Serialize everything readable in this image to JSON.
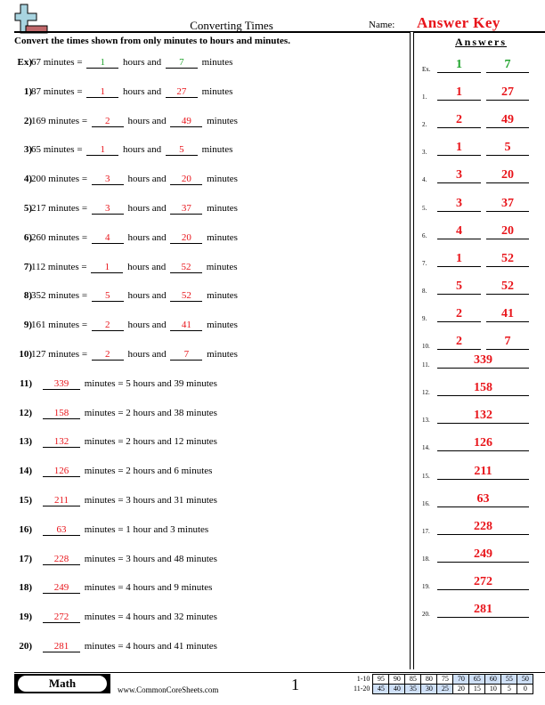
{
  "header": {
    "title": "Converting Times",
    "name_label": "Name:",
    "name_value": "Answer Key",
    "instructions": "Convert the times shown from only minutes to hours and minutes."
  },
  "questions": [
    {
      "num": "Ex)",
      "minutes": "67 minutes =",
      "hours": "1",
      "mins": "7",
      "example": true
    },
    {
      "num": "1)",
      "minutes": "87 minutes =",
      "hours": "1",
      "mins": "27"
    },
    {
      "num": "2)",
      "minutes": "169 minutes =",
      "hours": "2",
      "mins": "49"
    },
    {
      "num": "3)",
      "minutes": "65 minutes =",
      "hours": "1",
      "mins": "5"
    },
    {
      "num": "4)",
      "minutes": "200 minutes =",
      "hours": "3",
      "mins": "20"
    },
    {
      "num": "5)",
      "minutes": "217 minutes =",
      "hours": "3",
      "mins": "37"
    },
    {
      "num": "6)",
      "minutes": "260 minutes =",
      "hours": "4",
      "mins": "20"
    },
    {
      "num": "7)",
      "minutes": "112 minutes =",
      "hours": "1",
      "mins": "52"
    },
    {
      "num": "8)",
      "minutes": "352 minutes =",
      "hours": "5",
      "mins": "52"
    },
    {
      "num": "9)",
      "minutes": "161 minutes =",
      "hours": "2",
      "mins": "41"
    },
    {
      "num": "10)",
      "minutes": "127 minutes =",
      "hours": "2",
      "mins": "7"
    }
  ],
  "questions_part2": [
    {
      "num": "11)",
      "answer": "339",
      "text": "minutes = 5 hours and 39 minutes"
    },
    {
      "num": "12)",
      "answer": "158",
      "text": "minutes = 2 hours and 38 minutes"
    },
    {
      "num": "13)",
      "answer": "132",
      "text": "minutes = 2 hours and 12 minutes"
    },
    {
      "num": "14)",
      "answer": "126",
      "text": "minutes = 2 hours and 6 minutes"
    },
    {
      "num": "15)",
      "answer": "211",
      "text": "minutes = 3 hours and 31 minutes"
    },
    {
      "num": "16)",
      "answer": "63",
      "text": "minutes = 1 hour and 3 minutes"
    },
    {
      "num": "17)",
      "answer": "228",
      "text": "minutes = 3 hours and 48 minutes"
    },
    {
      "num": "18)",
      "answer": "249",
      "text": "minutes = 4 hours and 9 minutes"
    },
    {
      "num": "19)",
      "answer": "272",
      "text": "minutes = 4 hours and 32 minutes"
    },
    {
      "num": "20)",
      "answer": "281",
      "text": "minutes = 4 hours and 41 minutes"
    }
  ],
  "labels": {
    "hours_and": "hours and",
    "minutes": "minutes"
  },
  "answers_panel": {
    "title": "Answers",
    "pairs": [
      {
        "label": "Ex.",
        "a": "1",
        "b": "7",
        "example": true
      },
      {
        "label": "1.",
        "a": "1",
        "b": "27"
      },
      {
        "label": "2.",
        "a": "2",
        "b": "49"
      },
      {
        "label": "3.",
        "a": "1",
        "b": "5"
      },
      {
        "label": "4.",
        "a": "3",
        "b": "20"
      },
      {
        "label": "5.",
        "a": "3",
        "b": "37"
      },
      {
        "label": "6.",
        "a": "4",
        "b": "20"
      },
      {
        "label": "7.",
        "a": "1",
        "b": "52"
      },
      {
        "label": "8.",
        "a": "5",
        "b": "52"
      },
      {
        "label": "9.",
        "a": "2",
        "b": "41"
      },
      {
        "label": "10.",
        "a": "2",
        "b": "7"
      }
    ],
    "singles": [
      {
        "label": "11.",
        "a": "339"
      },
      {
        "label": "12.",
        "a": "158"
      },
      {
        "label": "13.",
        "a": "132"
      },
      {
        "label": "14.",
        "a": "126"
      },
      {
        "label": "15.",
        "a": "211"
      },
      {
        "label": "16.",
        "a": "63"
      },
      {
        "label": "17.",
        "a": "228"
      },
      {
        "label": "18.",
        "a": "249"
      },
      {
        "label": "19.",
        "a": "272"
      },
      {
        "label": "20.",
        "a": "281"
      }
    ]
  },
  "footer": {
    "subject": "Math",
    "site": "www.CommonCoreSheets.com",
    "page": "1",
    "score_rows": [
      {
        "label": "1-10",
        "cells": [
          "95",
          "90",
          "85",
          "80",
          "75",
          "70",
          "65",
          "60",
          "55",
          "50"
        ],
        "shaded": [
          false,
          false,
          false,
          false,
          false,
          true,
          true,
          true,
          true,
          true
        ]
      },
      {
        "label": "11-20",
        "cells": [
          "45",
          "40",
          "35",
          "30",
          "25",
          "20",
          "15",
          "10",
          "5",
          "0"
        ],
        "shaded": [
          true,
          true,
          true,
          true,
          true,
          false,
          false,
          false,
          false,
          false
        ]
      }
    ]
  },
  "colors": {
    "answer_red": "#e8141a",
    "example_green": "#1fa32c",
    "score_shade": "#cfe0f7",
    "logo_cross": "#a8d4e0",
    "logo_bar": "#c0676a"
  }
}
